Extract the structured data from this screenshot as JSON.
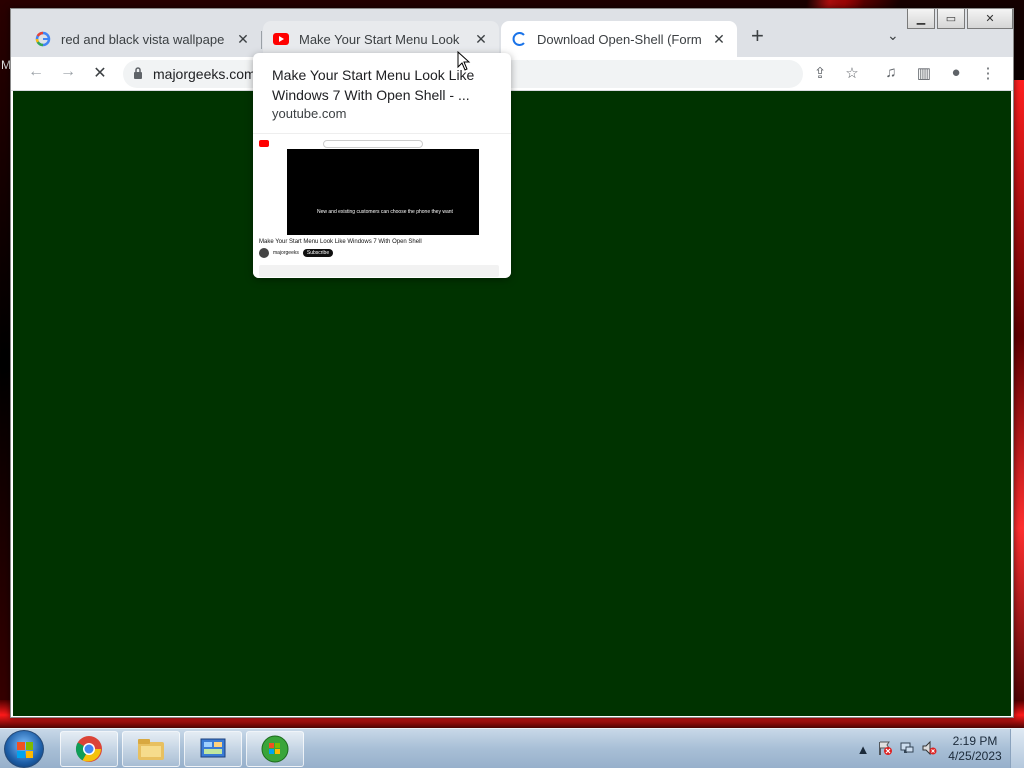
{
  "desktop": {
    "left_edge_letter": "M"
  },
  "browser": {
    "tabs": [
      {
        "title": "red and black vista wallpaper - G",
        "icon": "google-icon",
        "close": "✕"
      },
      {
        "title": "Make Your Start Menu Look Like",
        "icon": "youtube-icon",
        "close": "✕"
      },
      {
        "title": "Download Open-Shell (Formerly",
        "icon": "loading-spinner-icon",
        "close": "✕"
      }
    ],
    "new_tab": "+",
    "tab_search": "⌄",
    "window_controls": {
      "minimize": "▁",
      "maximize": "▭",
      "close": "✕"
    },
    "toolbar": {
      "back": "←",
      "forward": "→",
      "stop": "✕",
      "url": "majorgeeks.com",
      "share": "⇪",
      "bookmark": "☆",
      "media": "♫",
      "side_panel": "▥",
      "profile": "●",
      "menu": "⋮"
    },
    "content_color": "#003300"
  },
  "hover_card": {
    "title": "Make Your Start Menu Look Like Windows 7 With Open Shell - ...",
    "domain": "youtube.com",
    "preview": {
      "caption": "New and existing customers can choose the phone they want",
      "video_title": "Make Your Start Menu Look Like Windows 7 With Open Shell",
      "channel": "majorgeeks",
      "subscribe": "Subscribe"
    }
  },
  "taskbar": {
    "pinned": [
      "chrome-icon",
      "explorer-icon",
      "control-panel-icon",
      "windows-update-icon"
    ],
    "tray": {
      "show_hidden": "▲",
      "clock_time": "2:19 PM",
      "clock_date": "4/25/2023"
    }
  }
}
